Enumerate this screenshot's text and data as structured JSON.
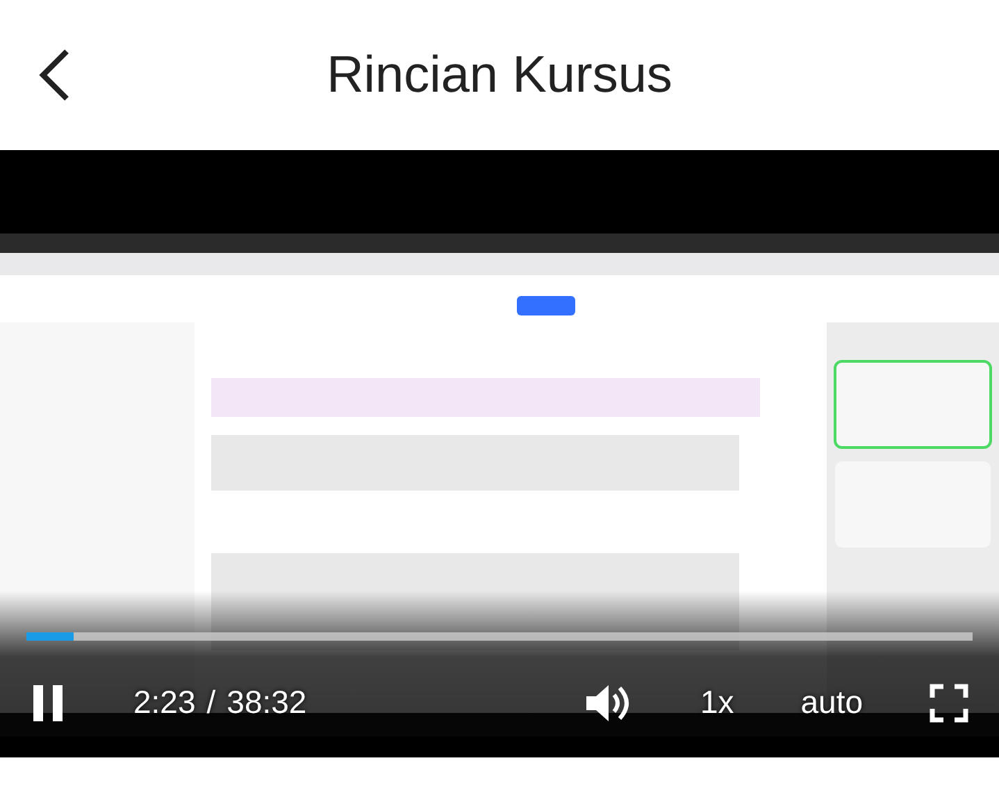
{
  "header": {
    "title": "Rincian Kursus"
  },
  "video": {
    "kind": "picture",
    "progress": {
      "played": {
        "level": 0.05
      }
    },
    "playing": true,
    "current_time": "2:23",
    "separator": "/",
    "duration": "38:32",
    "speed": "1x",
    "quality": "auto"
  }
}
